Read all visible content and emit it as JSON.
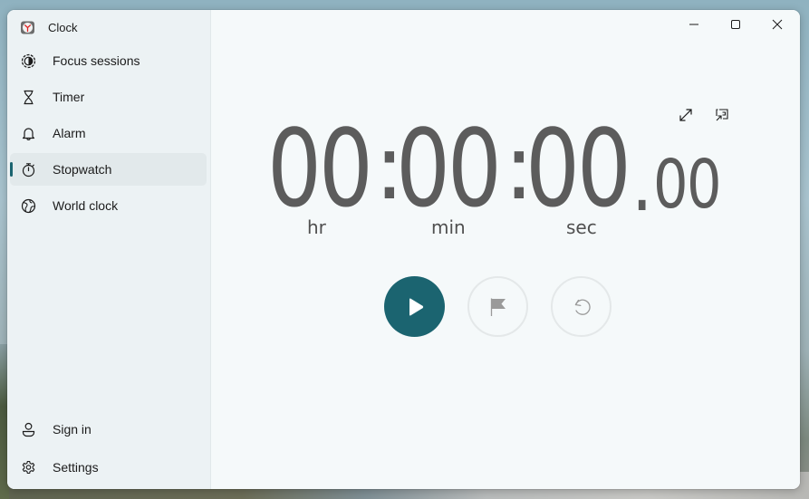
{
  "app": {
    "title": "Clock",
    "icon": "clock-app-icon"
  },
  "sidebar": {
    "items": [
      {
        "label": "Focus sessions",
        "icon": "focus-icon",
        "active": false
      },
      {
        "label": "Timer",
        "icon": "hourglass-icon",
        "active": false
      },
      {
        "label": "Alarm",
        "icon": "bell-icon",
        "active": false
      },
      {
        "label": "Stopwatch",
        "icon": "stopwatch-icon",
        "active": true
      },
      {
        "label": "World clock",
        "icon": "globe-icon",
        "active": false
      }
    ],
    "bottom_items": [
      {
        "label": "Sign in",
        "icon": "person-icon"
      },
      {
        "label": "Settings",
        "icon": "gear-icon"
      }
    ]
  },
  "window_controls": {
    "minimize": "minimize-icon",
    "maximize": "maximize-icon",
    "close": "close-icon"
  },
  "stopwatch": {
    "hours": "00",
    "minutes": "00",
    "seconds": "00",
    "hundredths": "00",
    "separator": ":",
    "decimal": ".",
    "units": {
      "hr": "hr",
      "min": "min",
      "sec": "sec"
    },
    "tools": {
      "expand": "expand-icon",
      "keep_on_top": "compact-overlay-icon"
    },
    "controls": {
      "start": "play-icon",
      "lap": "flag-icon",
      "reset": "reset-icon"
    }
  },
  "colors": {
    "accent": "#1b6470",
    "digits": "#5c5c5c",
    "sidebar_bg": "#ecf2f4",
    "main_bg": "#f5f9fa"
  }
}
